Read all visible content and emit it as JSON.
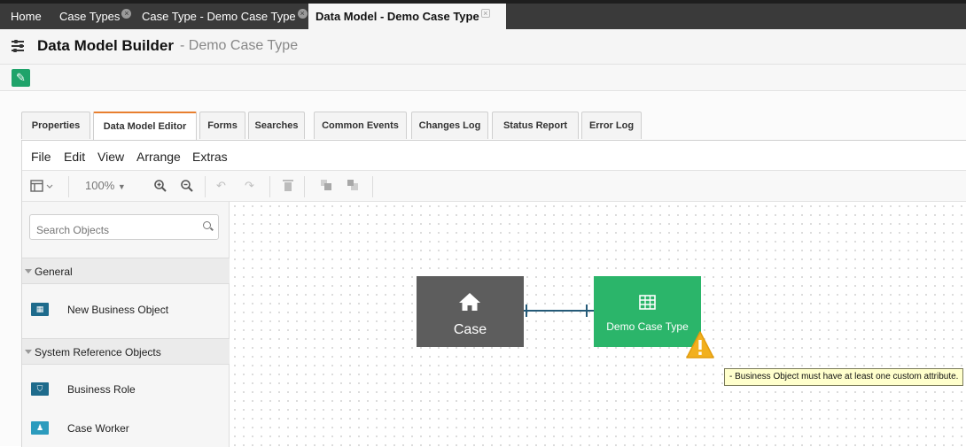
{
  "top_tabs": [
    {
      "label": "Home"
    },
    {
      "label": "Case Types"
    },
    {
      "label": "Case Type - Demo Case Type"
    },
    {
      "label": "Data Model - Demo Case Type",
      "active": true
    }
  ],
  "header": {
    "title": "Data Model Builder",
    "subtitle": "- Demo Case Type",
    "icon": "sliders-icon"
  },
  "edit_button": {
    "icon": "pencil-icon",
    "color": "#1fa36a"
  },
  "tabs": [
    {
      "label": "Properties"
    },
    {
      "label": "Data Model Editor",
      "active": true
    },
    {
      "label": "Forms"
    },
    {
      "label": "Searches"
    },
    {
      "label": "Common Events"
    },
    {
      "label": "Changes Log"
    },
    {
      "label": "Status Report"
    },
    {
      "label": "Error Log"
    }
  ],
  "menu": [
    "File",
    "Edit",
    "View",
    "Arrange",
    "Extras"
  ],
  "toolbar": {
    "zoom": "100%"
  },
  "sidebar": {
    "search_placeholder": "Search Objects",
    "sections": [
      {
        "label": "General",
        "items": [
          {
            "label": "New Business Object",
            "icon": "table-icon"
          }
        ]
      },
      {
        "label": "System Reference Objects",
        "items": [
          {
            "label": "Business Role",
            "icon": "shield-icon"
          },
          {
            "label": "Case Worker",
            "icon": "user-icon"
          }
        ]
      }
    ]
  },
  "canvas": {
    "nodes": [
      {
        "label": "Case",
        "icon": "home-icon",
        "color": "#5d5d5d"
      },
      {
        "label": "Demo Case Type",
        "icon": "table-icon",
        "color": "#2bb56a"
      }
    ],
    "warning_tooltip": "- Business Object must have at least one custom attribute."
  }
}
